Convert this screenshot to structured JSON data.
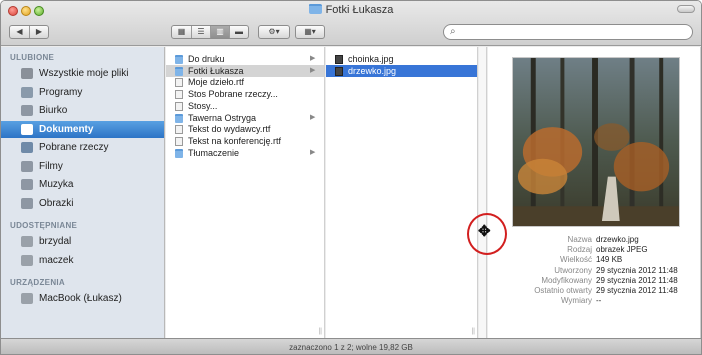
{
  "window": {
    "title": "Fotki Łukasza",
    "status": "zaznaczono 1 z 2; wolne 19,82 GB"
  },
  "toolbar": {
    "back_icon": "◀",
    "forward_icon": "▶",
    "view_icons": [
      "▦",
      "☰",
      "▥",
      "▬"
    ],
    "action_label": "⚙▾",
    "arrange_label": "▦▾",
    "search_placeholder": ""
  },
  "sidebar": {
    "sections": [
      {
        "header": "ULUBIONE",
        "items": [
          {
            "label": "Wszystkie moje pliki",
            "icon": "all-files-icon",
            "color": "#8a9099"
          },
          {
            "label": "Programy",
            "icon": "applications-icon",
            "color": "#8a9aab"
          },
          {
            "label": "Biurko",
            "icon": "desktop-icon",
            "color": "#8e97a3"
          },
          {
            "label": "Dokumenty",
            "icon": "documents-icon",
            "color": "#ffffff",
            "selected": true
          },
          {
            "label": "Pobrane rzeczy",
            "icon": "downloads-icon",
            "color": "#6f8aa8"
          },
          {
            "label": "Filmy",
            "icon": "movies-icon",
            "color": "#8e97a3"
          },
          {
            "label": "Muzyka",
            "icon": "music-icon",
            "color": "#8e97a3"
          },
          {
            "label": "Obrazki",
            "icon": "pictures-icon",
            "color": "#8e97a3"
          }
        ]
      },
      {
        "header": "UDOSTĘPNIANE",
        "items": [
          {
            "label": "brzydal",
            "icon": "shared-computer-icon",
            "color": "#9aa1a9"
          },
          {
            "label": "maczek",
            "icon": "shared-computer-icon",
            "color": "#9aa1a9"
          }
        ]
      },
      {
        "header": "URZĄDZENIA",
        "items": [
          {
            "label": "MacBook (Łukasz)",
            "icon": "laptop-icon",
            "color": "#9aa1a9"
          }
        ]
      }
    ]
  },
  "column1": [
    {
      "label": "Do druku",
      "kind": "folder",
      "arrow": true
    },
    {
      "label": "Fotki Łukasza",
      "kind": "folder",
      "arrow": true,
      "selected": true
    },
    {
      "label": "Moje dzieło.rtf",
      "kind": "doc"
    },
    {
      "label": "Stos Pobrane rzeczy...",
      "kind": "doc"
    },
    {
      "label": "Stosy...",
      "kind": "doc"
    },
    {
      "label": "Tawerna Ostryga",
      "kind": "folder",
      "arrow": true
    },
    {
      "label": "Tekst do wydawcy.rtf",
      "kind": "doc"
    },
    {
      "label": "Tekst na konferencję.rtf",
      "kind": "doc"
    },
    {
      "label": "Tłumaczenie",
      "kind": "folder",
      "arrow": true
    }
  ],
  "column2": [
    {
      "label": "choinka.jpg",
      "kind": "image"
    },
    {
      "label": "drzewko.jpg",
      "kind": "image",
      "selected": true
    }
  ],
  "preview": {
    "meta": [
      {
        "label": "Nazwa",
        "value": "drzewko.jpg"
      },
      {
        "label": "Rodzaj",
        "value": "obrazek JPEG"
      },
      {
        "label": "Wielkość",
        "value": "149 KB"
      },
      {
        "label": "Utworzony",
        "value": "29 stycznia 2012 11:48"
      },
      {
        "label": "Modyfikowany",
        "value": "29 stycznia 2012 11:48"
      },
      {
        "label": "Ostatnio otwarty",
        "value": "29 stycznia 2012 11:48"
      },
      {
        "label": "Wymiary",
        "value": "--"
      }
    ]
  },
  "colors": {
    "selection_blue": "#3875d7",
    "sidebar_bg": "#dfe5ed",
    "annotation_red": "#d21f1f"
  }
}
